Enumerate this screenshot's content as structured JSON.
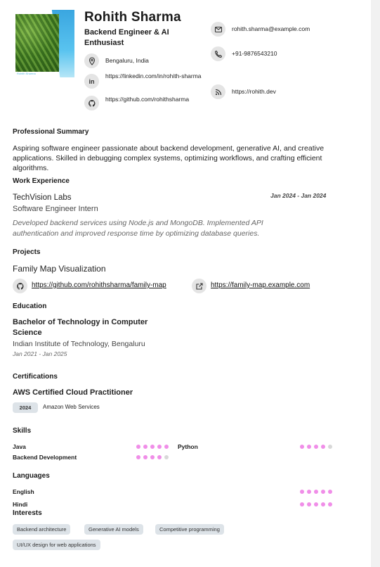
{
  "header": {
    "photo_caption": "Rohith Sharma",
    "name": "Rohith Sharma",
    "role": "Backend Engineer & AI Enthusiast",
    "location": "Bengaluru, India",
    "linkedin": "https://linkedin.com/in/rohith-sharma",
    "github": "https://github.com/rohithsharma",
    "email": "rohith.sharma@example.com",
    "phone": "+91-9876543210",
    "website": "https://rohith.dev"
  },
  "summary": {
    "heading": "Professional Summary",
    "text": "Aspiring software engineer passionate about backend development, generative AI, and creative applications. Skilled in debugging complex systems, optimizing workflows, and crafting efficient algorithms."
  },
  "experience": {
    "heading": "Work Experience",
    "company": "TechVision Labs",
    "dates": "Jan 2024 - Jan 2024",
    "title": "Software Engineer Intern",
    "description": "Developed backend services using Node.js and MongoDB. Implemented API authentication and improved response time by optimizing database queries."
  },
  "projects": {
    "heading": "Projects",
    "name": "Family Map Visualization",
    "repo": "https://github.com/rohithsharma/family-map",
    "demo": "https://family-map.example.com"
  },
  "education": {
    "heading": "Education",
    "degree": "Bachelor of Technology in Computer Science",
    "school": "Indian Institute of Technology, Bengaluru",
    "dates": "Jan 2021 - Jan 2025"
  },
  "certifications": {
    "heading": "Certifications",
    "name": "AWS Certified Cloud Practitioner",
    "year": "2024",
    "issuer": "Amazon Web Services"
  },
  "skills": {
    "heading": "Skills",
    "items": [
      {
        "name": "Java",
        "level": 5
      },
      {
        "name": "Python",
        "level": 4
      },
      {
        "name": "Backend Development",
        "level": 4
      }
    ]
  },
  "languages": {
    "heading": "Languages",
    "items": [
      {
        "name": "English",
        "level": 5
      },
      {
        "name": "Hindi",
        "level": 5
      }
    ]
  },
  "interests": {
    "heading": "Interests",
    "items": [
      "Backend architecture",
      "Generative AI models",
      "Competitive programming",
      "UI/UX design for web applications"
    ]
  },
  "colors": {
    "accent_dot": "#f08ee8",
    "chip": "#dde3e8",
    "icon_bg": "#e4e4e4"
  },
  "icons": [
    "location-icon",
    "linkedin-icon",
    "github-icon",
    "mail-icon",
    "phone-icon",
    "rss-icon",
    "external-link-icon"
  ]
}
